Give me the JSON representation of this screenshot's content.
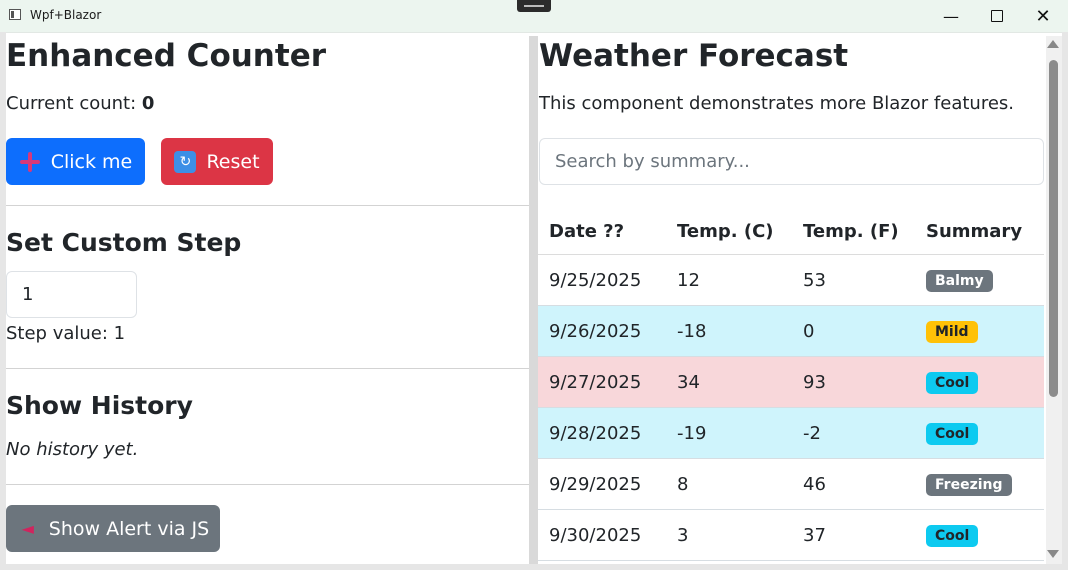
{
  "window": {
    "title": "Wpf+Blazor",
    "minimize_icon": "minimize-icon",
    "maximize_icon": "maximize-icon",
    "close_icon": "close-icon"
  },
  "counter": {
    "title": "Enhanced Counter",
    "count_label": "Current count:",
    "count_value": "0",
    "click_label": "Click me",
    "click_icon": "plus-icon",
    "reset_label": "Reset",
    "reset_icon": "arrows-counterclockwise-icon"
  },
  "step": {
    "title": "Set Custom Step",
    "input_value": "1",
    "value_text": "Step value: 1"
  },
  "history": {
    "title": "Show History",
    "empty_text": "No history yet."
  },
  "alert": {
    "label": "Show Alert via JS",
    "icon": "megaphone-icon"
  },
  "weather": {
    "title": "Weather Forecast",
    "description": "This component demonstrates more Blazor features.",
    "search_placeholder": "Search by summary...",
    "headers": [
      "Date ??",
      "Temp. (C)",
      "Temp. (F)",
      "Summary"
    ],
    "rows": [
      {
        "date": "9/25/2025",
        "temp_c": "12",
        "temp_f": "53",
        "summary": "Balmy",
        "row_bg": "#ffffff",
        "badge_bg": "#6c757d",
        "badge_fg": "#ffffff"
      },
      {
        "date": "9/26/2025",
        "temp_c": "-18",
        "temp_f": "0",
        "summary": "Mild",
        "row_bg": "#cff4fc",
        "badge_bg": "#ffc107",
        "badge_fg": "#212529"
      },
      {
        "date": "9/27/2025",
        "temp_c": "34",
        "temp_f": "93",
        "summary": "Cool",
        "row_bg": "#f8d7da",
        "badge_bg": "#0dcaf0",
        "badge_fg": "#212529"
      },
      {
        "date": "9/28/2025",
        "temp_c": "-19",
        "temp_f": "-2",
        "summary": "Cool",
        "row_bg": "#cff4fc",
        "badge_bg": "#0dcaf0",
        "badge_fg": "#212529"
      },
      {
        "date": "9/29/2025",
        "temp_c": "8",
        "temp_f": "46",
        "summary": "Freezing",
        "row_bg": "#ffffff",
        "badge_bg": "#6c757d",
        "badge_fg": "#ffffff"
      },
      {
        "date": "9/30/2025",
        "temp_c": "3",
        "temp_f": "37",
        "summary": "Cool",
        "row_bg": "#ffffff",
        "badge_bg": "#0dcaf0",
        "badge_fg": "#212529"
      }
    ]
  },
  "colors": {
    "primary": "#0d6efd",
    "danger": "#dc3545",
    "secondary": "#6c757d",
    "titlebar": "#ecf5ef"
  }
}
